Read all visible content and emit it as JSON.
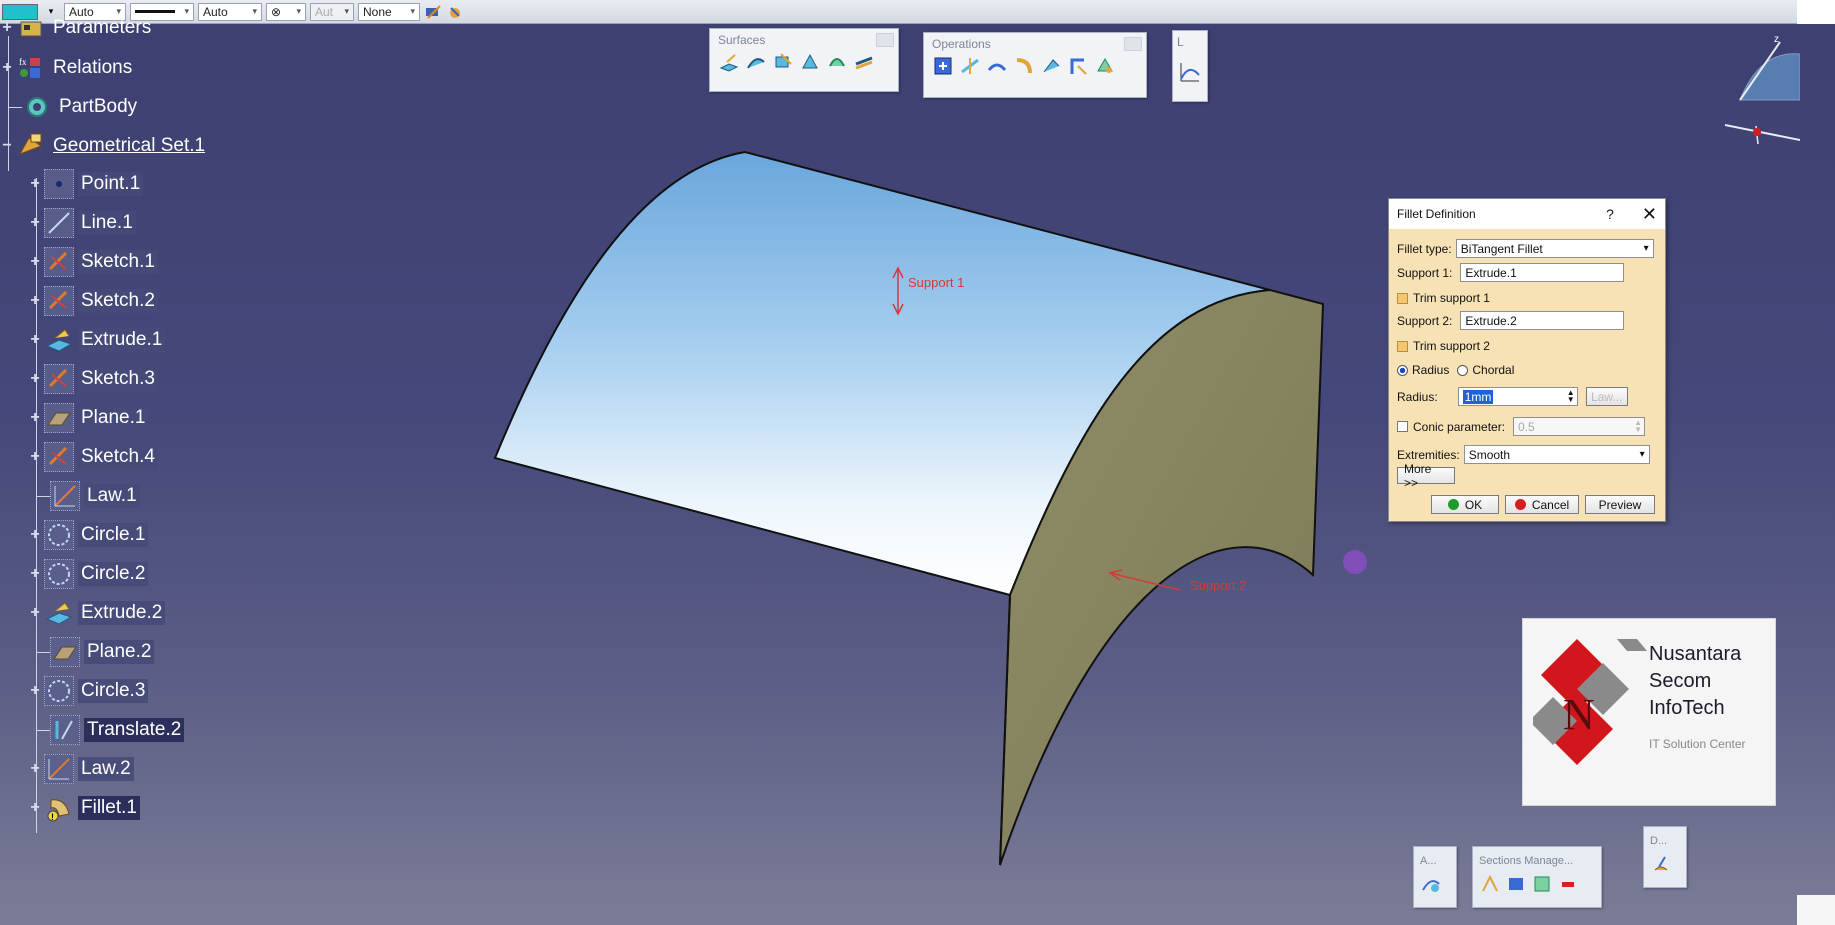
{
  "topbar": {
    "color_swatch": "#21c0cc",
    "dropdown1": "Auto",
    "dropdown2": "Auto",
    "dropdown3": "⊗",
    "dropdown4": "Aut",
    "dropdown5": "None"
  },
  "tree": {
    "items": [
      {
        "label": "Parameters"
      },
      {
        "label": "Relations"
      },
      {
        "label": "PartBody"
      },
      {
        "label": "Geometrical Set.1"
      },
      {
        "label": "Point.1"
      },
      {
        "label": "Line.1"
      },
      {
        "label": "Sketch.1"
      },
      {
        "label": "Sketch.2"
      },
      {
        "label": "Extrude.1"
      },
      {
        "label": "Sketch.3"
      },
      {
        "label": "Plane.1"
      },
      {
        "label": "Sketch.4"
      },
      {
        "label": "Law.1"
      },
      {
        "label": "Circle.1"
      },
      {
        "label": "Circle.2"
      },
      {
        "label": "Extrude.2"
      },
      {
        "label": "Plane.2"
      },
      {
        "label": "Circle.3"
      },
      {
        "label": "Translate.2"
      },
      {
        "label": "Law.2"
      },
      {
        "label": "Fillet.1"
      }
    ]
  },
  "toolbars": {
    "surfaces_title": "Surfaces",
    "operations_title": "Operations",
    "small_title": "L",
    "analysis_title": "A...",
    "sections_title": "Sections Manage...",
    "d_title": "D..."
  },
  "viewport": {
    "support1_label": "Support 1",
    "support2_label": "Support 2",
    "surface1_color": "#8fc4ec",
    "surface2_color": "#8c8a63"
  },
  "dialog": {
    "title": "Fillet Definition",
    "help": "?",
    "close": "✕",
    "fillet_type_label": "Fillet type:",
    "fillet_type_value": "BiTangent Fillet",
    "support1_label": "Support 1:",
    "support1_value": "Extrude.1",
    "trim1_label": "Trim support 1",
    "support2_label": "Support 2:",
    "support2_value": "Extrude.2",
    "trim2_label": "Trim support 2",
    "radius_option": "Radius",
    "chordal_option": "Chordal",
    "radius_label": "Radius:",
    "radius_value": "1mm",
    "law_button": "Law...",
    "conic_label": "Conic parameter:",
    "conic_value": "0.5",
    "extremities_label": "Extremities:",
    "extremities_value": "Smooth",
    "more_button": "More >>",
    "ok_button": "OK",
    "cancel_button": "Cancel",
    "preview_button": "Preview"
  },
  "logo": {
    "line1": "Nusantara",
    "line2": "Secom",
    "line3": "InfoTech",
    "subtitle": "IT Solution Center",
    "letter": "N"
  }
}
